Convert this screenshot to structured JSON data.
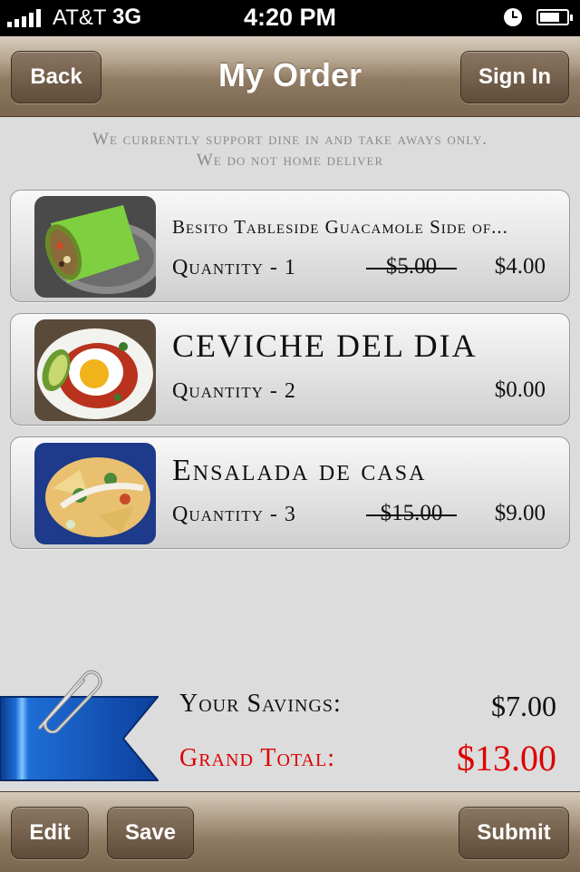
{
  "status_bar": {
    "carrier": "AT&T",
    "network": "3G",
    "time": "4:20 PM"
  },
  "nav": {
    "back_label": "Back",
    "title": "My Order",
    "sign_in_label": "Sign In"
  },
  "notice": {
    "line1": "We currently support dine in and take aways only.",
    "line2": "We do not home deliver"
  },
  "items": [
    {
      "title": "Besito Tableside Guacamole Side of...",
      "quantity": "Quantity - 1",
      "original_price": "$5.00",
      "price": "$4.00"
    },
    {
      "title": "CEVICHE DEL DIA",
      "quantity": "Quantity - 2",
      "price": "$0.00"
    },
    {
      "title": "Ensalada de casa",
      "quantity": "Quantity - 3",
      "original_price": "$15.00",
      "price": "$9.00"
    }
  ],
  "summary": {
    "savings_label": "Your Savings:",
    "savings_value": "$7.00",
    "total_label": "Grand Total:",
    "total_value": "$13.00"
  },
  "toolbar": {
    "edit_label": "Edit",
    "save_label": "Save",
    "submit_label": "Submit"
  },
  "colors": {
    "nav_brown": "#7a6650",
    "total_red": "#dd0000",
    "ribbon_blue": "#1f6fd0"
  }
}
